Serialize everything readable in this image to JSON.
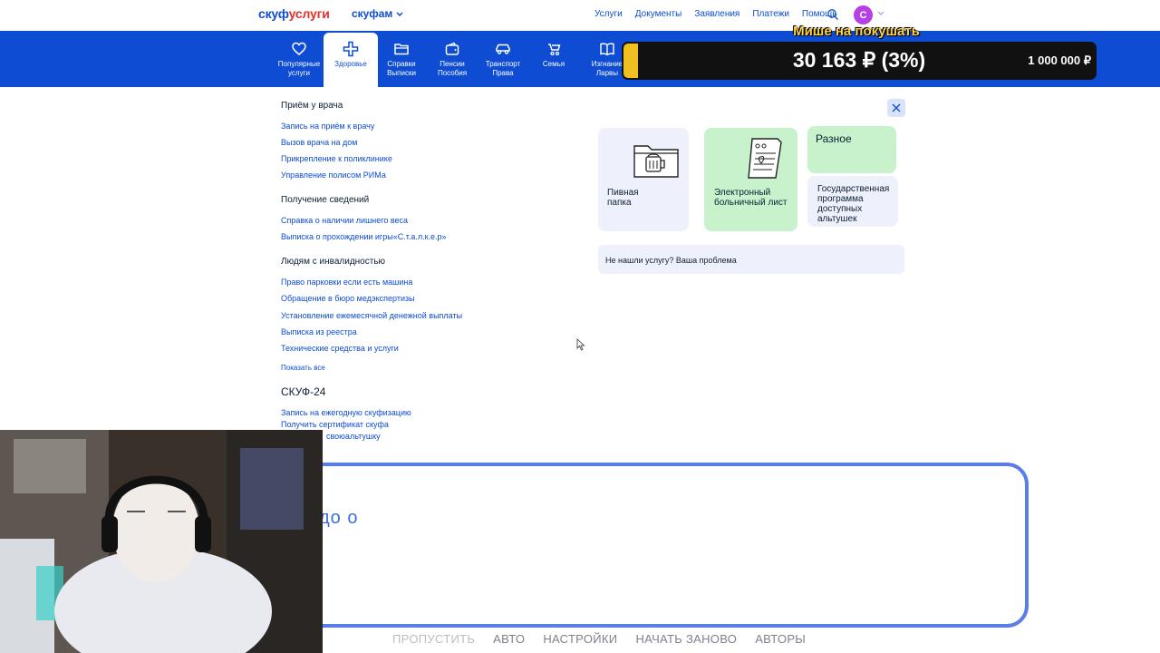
{
  "header": {
    "logo_part1": "скуф",
    "logo_part2": "услуги",
    "family_label": "скуфам",
    "nav": [
      "Услуги",
      "Документы",
      "Заявления",
      "Платежи",
      "Помощь"
    ],
    "avatar_letter": "С"
  },
  "categories": [
    {
      "label1": "Популярные",
      "label2": "услуги",
      "icon": "heart-icon"
    },
    {
      "label1": "Здоровье",
      "label2": "",
      "icon": "medical-cross-icon",
      "active": true
    },
    {
      "label1": "Справки",
      "label2": "Выписки",
      "icon": "folder-icon"
    },
    {
      "label1": "Пенсии",
      "label2": "Пособия",
      "icon": "wallet-icon"
    },
    {
      "label1": "Транспорт",
      "label2": "Права",
      "icon": "car-icon"
    },
    {
      "label1": "Семья",
      "label2": "",
      "icon": "stroller-icon"
    },
    {
      "label1": "Изгнание",
      "label2": "Ларвы",
      "icon": "book-icon"
    }
  ],
  "donation": {
    "title": "Мише на покушать",
    "amount": "30 163 ₽ (3%)",
    "goal": "1 000 000 ₽",
    "progress_fraction": 0.03,
    "fill_color": "#f0c020"
  },
  "services": {
    "sec1": {
      "title": "Приём у врача",
      "links": [
        "Запись на приём к врачу",
        "Вызов врача на дом",
        "Прикрепление к поликлинике",
        "Управление полисом РИМа"
      ]
    },
    "sec2": {
      "title": "Получение сведений",
      "links": [
        "Справка о наличии лишнего веса",
        "Выписка о прохождении игры«С.т.а.л.к.е.р»"
      ]
    },
    "sec3": {
      "title": "Людям с инвалидностью",
      "links": [
        "Право парковки если есть машина",
        "Обращение в бюро медэкспертизы",
        "Установление ежемесячной денежной выплаты",
        "Выписка из реестра",
        "Технические средства и услуги"
      ]
    },
    "show_all": "Показать все",
    "sec4": {
      "title": "СКУФ-24",
      "links": [
        "Запись на ежегодную скуфизацию",
        "Получить сертификат скуфа",
        "своюальтушку"
      ]
    }
  },
  "cards": {
    "beer_folder": "Пивная папка",
    "sick_leave": "Электронный больничный лист",
    "misc": "Разное",
    "state_program": "Государственная программа доступных альтушек"
  },
  "not_found": "Не нашли услугу? Ваша проблема",
  "dialog": {
    "text": "до о"
  },
  "bottom_menu": [
    "ПРОПУСТИТЬ",
    "АВТО",
    "НАСТРОЙКИ",
    "НАЧАТЬ ЗАНОВО",
    "АВТОРЫ"
  ],
  "colors": {
    "brand_blue": "#0d4cd3",
    "accent_red": "#e4312c",
    "card_lavender": "#eef1fc",
    "card_green": "#c8f2cc",
    "avatar_purple": "#b63fe6"
  }
}
